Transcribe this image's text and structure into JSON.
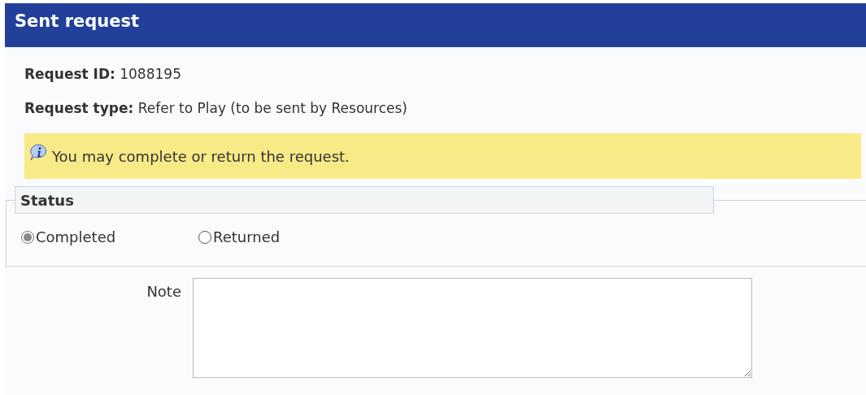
{
  "window": {
    "title": "Sent request"
  },
  "fields": [
    {
      "label": "Request ID:",
      "value": "1088195"
    },
    {
      "label": "Request type:",
      "value": "Refer to Play (to be sent by Resources)"
    }
  ],
  "info": {
    "text": "You may complete or return the request."
  },
  "status": {
    "legend": "Status",
    "options": [
      {
        "label": "Completed",
        "selected": true
      },
      {
        "label": "Returned",
        "selected": false
      }
    ]
  },
  "note": {
    "label": "Note"
  }
}
